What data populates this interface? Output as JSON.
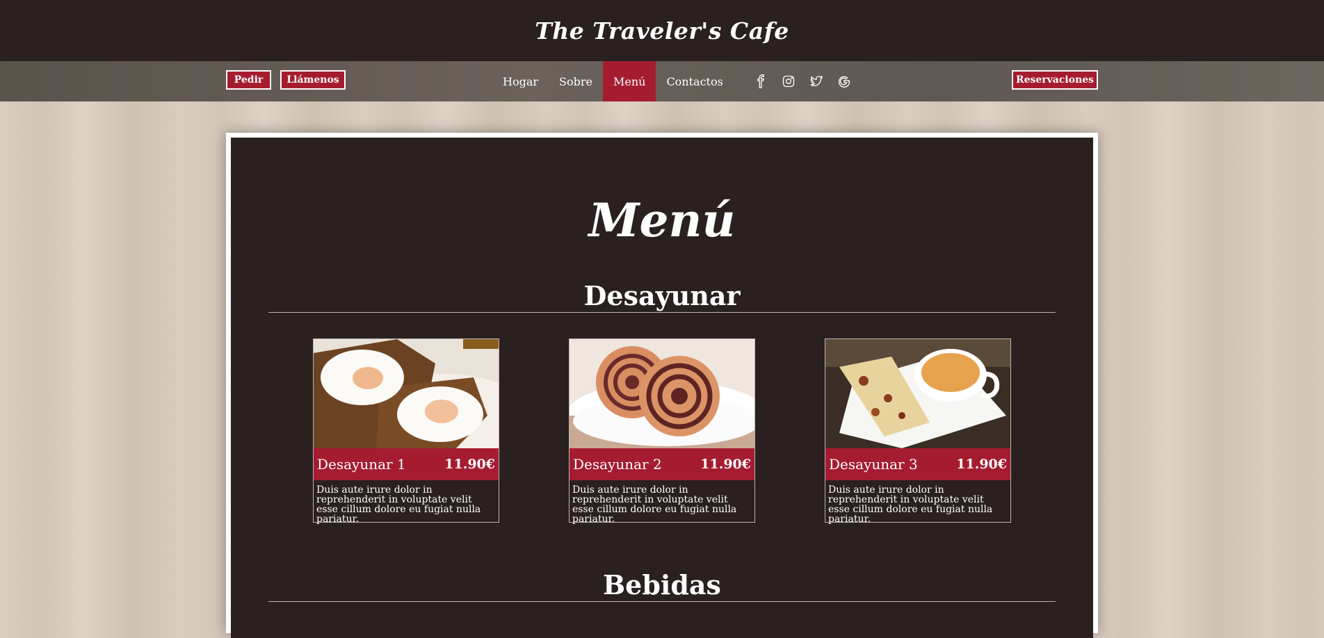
{
  "header": {
    "brand": "The Traveler's Cafe"
  },
  "nav": {
    "order_label": "Pedir",
    "call_label": "Llámenos",
    "links": [
      {
        "label": "Hogar"
      },
      {
        "label": "Sobre"
      },
      {
        "label": "Menú"
      },
      {
        "label": "Contactos"
      }
    ],
    "active_link": "Menú",
    "socials": [
      "facebook-icon",
      "instagram-icon",
      "twitter-icon",
      "google-icon"
    ],
    "reservations_label": "Reservaciones"
  },
  "main": {
    "title": "Menú",
    "sections": [
      {
        "title": "Desayunar",
        "items": [
          {
            "name": "Desayunar 1",
            "price": "11.90€",
            "description": "Duis aute irure dolor in reprehenderit in voluptate velit esse cillum dolore eu fugiat nulla pariatur."
          },
          {
            "name": "Desayunar 2",
            "price": "11.90€",
            "description": "Duis aute irure dolor in reprehenderit in voluptate velit esse cillum dolore eu fugiat nulla pariatur."
          },
          {
            "name": "Desayunar 3",
            "price": "11.90€",
            "description": "Duis aute irure dolor in reprehenderit in voluptate velit esse cillum dolore eu fugiat nulla pariatur."
          }
        ]
      },
      {
        "title": "Bebidas"
      }
    ]
  },
  "colors": {
    "accent": "#a51c30",
    "dark": "#2a2020",
    "white": "#ffffff"
  }
}
